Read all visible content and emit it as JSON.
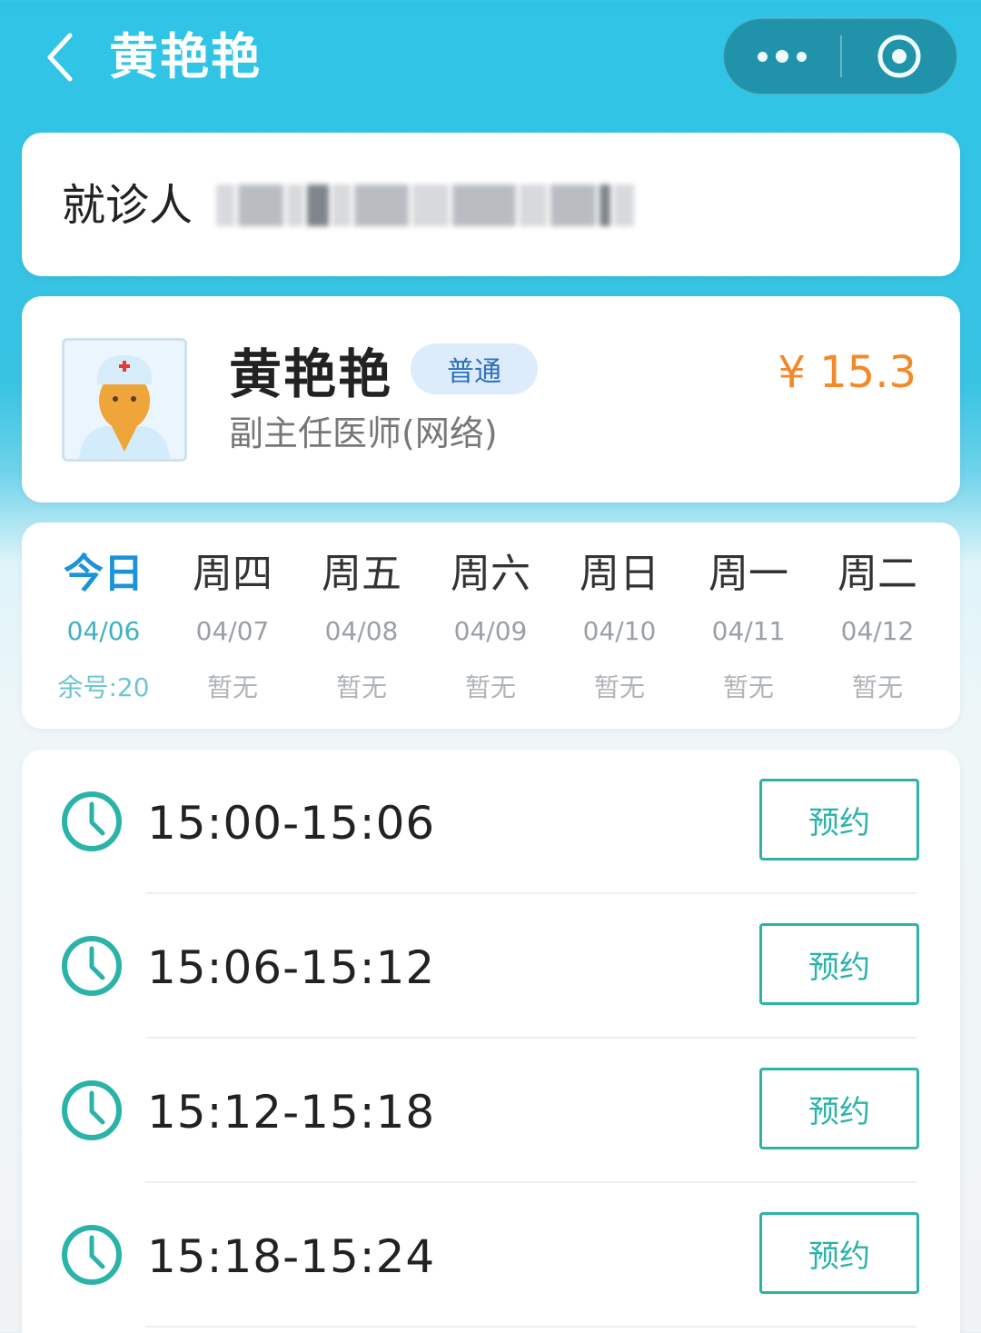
{
  "header": {
    "title": "黄艳艳"
  },
  "patient": {
    "label": "就诊人"
  },
  "doctor": {
    "name": "黄艳艳",
    "badge": "普通",
    "title": "副主任医师(网络)",
    "price": "¥ 15.3"
  },
  "days": [
    {
      "week": "今日",
      "date": "04/06",
      "status": "余号:20"
    },
    {
      "week": "周四",
      "date": "04/07",
      "status": "暂无"
    },
    {
      "week": "周五",
      "date": "04/08",
      "status": "暂无"
    },
    {
      "week": "周六",
      "date": "04/09",
      "status": "暂无"
    },
    {
      "week": "周日",
      "date": "04/10",
      "status": "暂无"
    },
    {
      "week": "周一",
      "date": "04/11",
      "status": "暂无"
    },
    {
      "week": "周二",
      "date": "04/12",
      "status": "暂无"
    }
  ],
  "slots": [
    {
      "time": "15:00-15:06",
      "button": "预约"
    },
    {
      "time": "15:06-15:12",
      "button": "预约"
    },
    {
      "time": "15:12-15:18",
      "button": "预约"
    },
    {
      "time": "15:18-15:24",
      "button": "预约"
    }
  ],
  "colors": {
    "accent": "#2bb3a8",
    "price": "#f08a2a",
    "header": "#2fc4e6",
    "active_day": "#1b93d6"
  },
  "icons": {
    "back": "chevron-left-icon",
    "more": "more-dots-icon",
    "close": "target-icon",
    "clock": "clock-icon"
  }
}
